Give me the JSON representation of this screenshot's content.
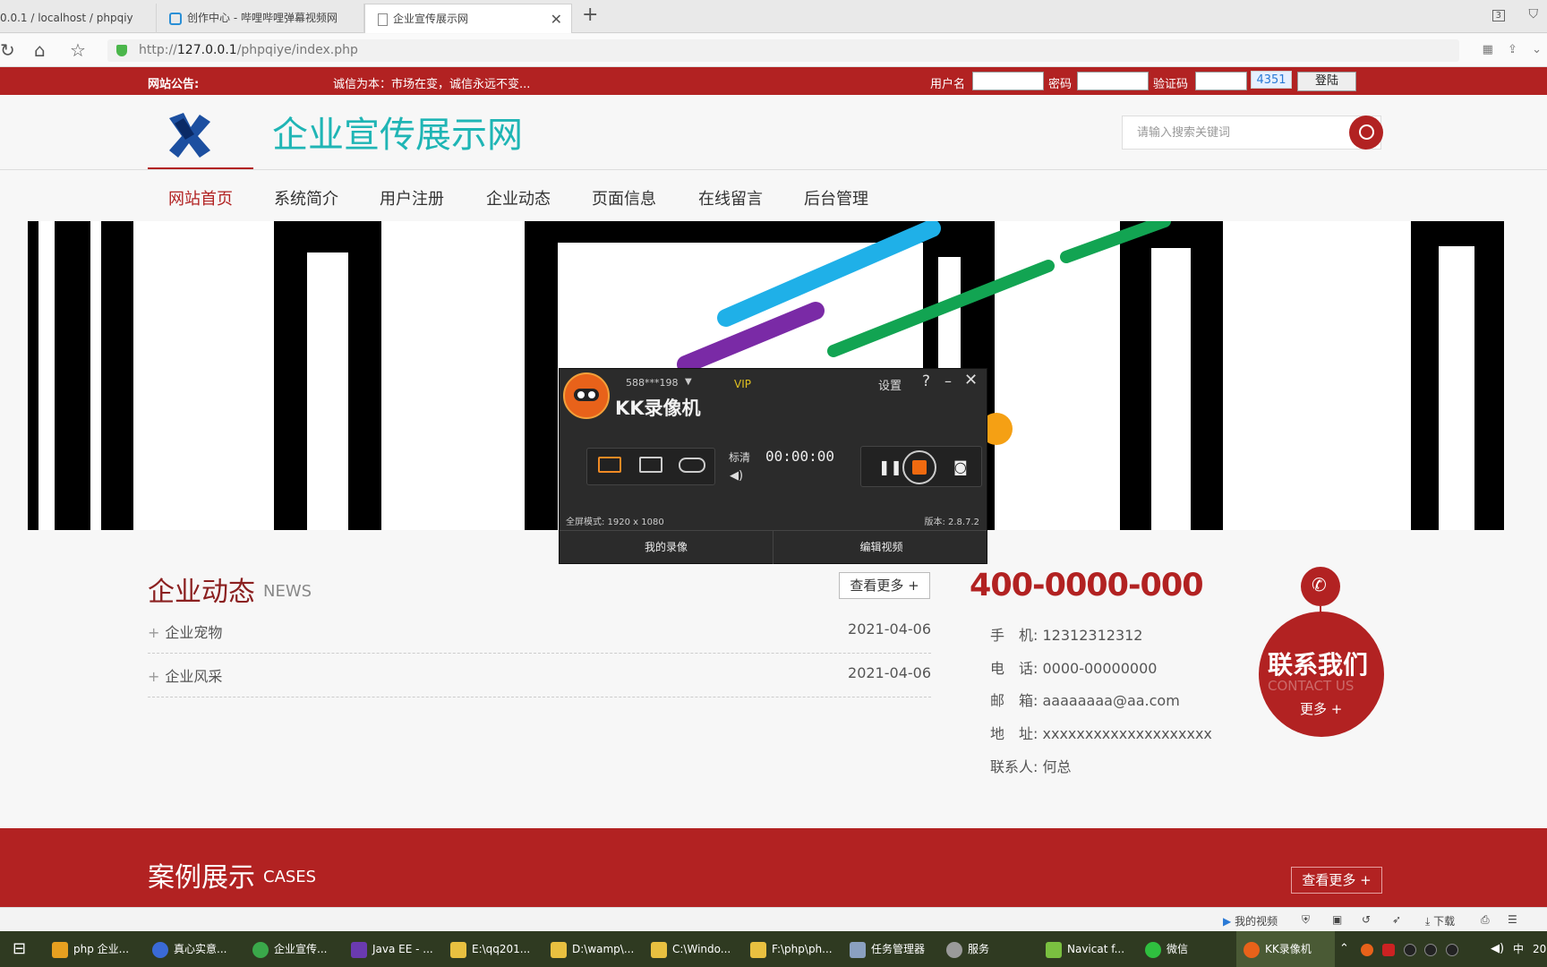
{
  "browser": {
    "tabs": [
      {
        "label": "0.0.1 / localhost / phpqiy"
      },
      {
        "label": "创作中心 - 哔哩哔哩弹幕视频网"
      },
      {
        "label": "企业宣传展示网"
      }
    ],
    "url_prefix": "http://",
    "url_host": "127.0.0.1",
    "url_path": "/phpqiye/index.php",
    "new_tab": "+",
    "tab_count": "3"
  },
  "notice": {
    "label": "网站公告:",
    "text": "诚信为本：市场在变，诚信永远不变...",
    "username_label": "用户名",
    "password_label": "密码",
    "captcha_label": "验证码",
    "captcha_value": "4351",
    "login_label": "登陆"
  },
  "header": {
    "title": "企业宣传展示网",
    "search_placeholder": "请输入搜索关键词"
  },
  "nav": {
    "items": [
      {
        "label": "网站首页"
      },
      {
        "label": "系统简介"
      },
      {
        "label": "用户注册"
      },
      {
        "label": "企业动态"
      },
      {
        "label": "页面信息"
      },
      {
        "label": "在线留言"
      },
      {
        "label": "后台管理"
      }
    ]
  },
  "recorder": {
    "account": "588***198",
    "vip": "VIP",
    "settings": "设置",
    "app_name": "KK录像机",
    "quality": "标清",
    "timer": "00:00:00",
    "mode": "全屏模式: 1920 x 1080",
    "version": "版本: 2.8.7.2",
    "my_videos": "我的录像",
    "edit_video": "编辑视频"
  },
  "news": {
    "title": "企业动态",
    "subtitle": "NEWS",
    "more": "查看更多 +",
    "items": [
      {
        "title": "企业宠物",
        "date": "2021-04-06"
      },
      {
        "title": "企业风采",
        "date": "2021-04-06"
      }
    ]
  },
  "contact": {
    "phone_big": "400-0000-000",
    "rows": [
      {
        "label": "手　机:",
        "value": "12312312312"
      },
      {
        "label": "电　话:",
        "value": "0000-00000000"
      },
      {
        "label": "邮　箱:",
        "value": "aaaaaaaa@aa.com"
      },
      {
        "label": "地　址:",
        "value": "xxxxxxxxxxxxxxxxxxxx"
      },
      {
        "label": "联系人:",
        "value": "何总"
      }
    ],
    "badge_title": "联系我们",
    "badge_sub": "CONTACT US",
    "badge_more": "更多 +"
  },
  "cases": {
    "title": "案例展示",
    "subtitle": "CASES",
    "more": "查看更多 +"
  },
  "statusbar": {
    "my_video": "我的视频",
    "download": "下载"
  },
  "taskbar": {
    "items": [
      {
        "label": "php 企业..."
      },
      {
        "label": "真心实意..."
      },
      {
        "label": "企业宣传..."
      },
      {
        "label": "Java EE - ..."
      },
      {
        "label": "E:\\qq201..."
      },
      {
        "label": "D:\\wamp\\..."
      },
      {
        "label": "C:\\Windo..."
      },
      {
        "label": "F:\\php\\ph..."
      },
      {
        "label": "任务管理器"
      },
      {
        "label": "服务"
      },
      {
        "label": "Navicat f..."
      },
      {
        "label": "微信"
      },
      {
        "label": "KK录像机"
      }
    ],
    "ime": "中",
    "clock_fragment": "20"
  }
}
